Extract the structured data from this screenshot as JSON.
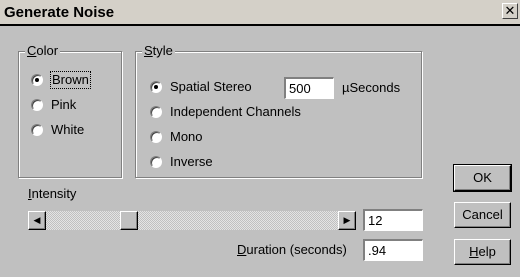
{
  "window": {
    "title": "Generate Noise",
    "close_glyph": "✕"
  },
  "color_group": {
    "label": "Color",
    "options": [
      {
        "label": "Brown",
        "checked": true
      },
      {
        "label": "Pink",
        "checked": false
      },
      {
        "label": "White",
        "checked": false
      }
    ]
  },
  "style_group": {
    "label": "Style",
    "options": [
      {
        "label": "Spatial Stereo",
        "checked": true
      },
      {
        "label": "Independent Channels",
        "checked": false
      },
      {
        "label": "Mono",
        "checked": false
      },
      {
        "label": "Inverse",
        "checked": false
      }
    ],
    "delay_value": "500",
    "delay_unit": "µSeconds"
  },
  "intensity": {
    "label": "Intensity",
    "value": "12",
    "slider_position": 0.27,
    "left_arrow": "◀",
    "right_arrow": "▶"
  },
  "duration": {
    "label": "Duration (seconds)",
    "value": ".94"
  },
  "buttons": {
    "ok": "OK",
    "cancel": "Cancel",
    "help": "Help"
  }
}
